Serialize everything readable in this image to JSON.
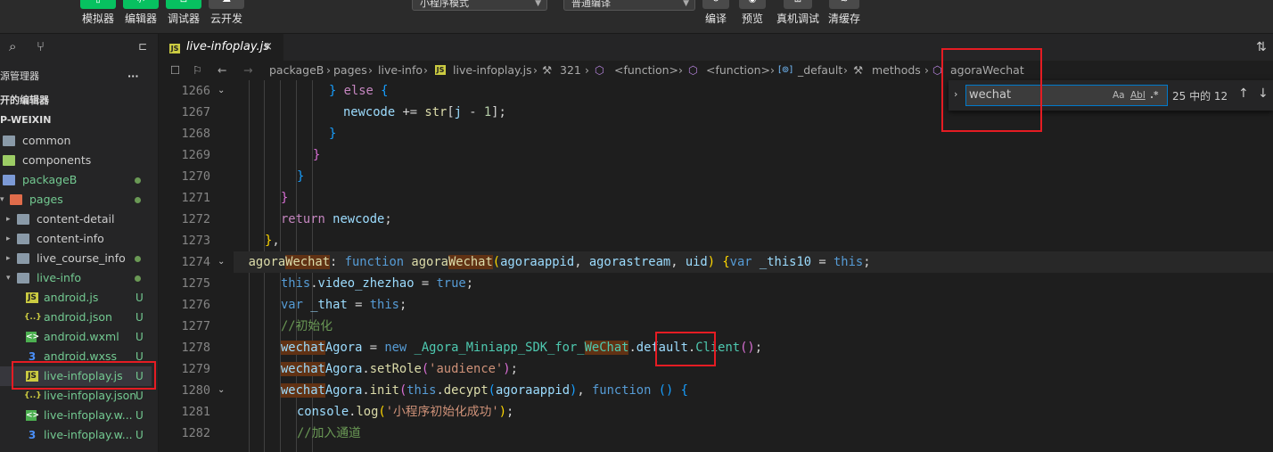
{
  "toolbar": {
    "buttons": [
      {
        "label": "模拟器"
      },
      {
        "label": "编辑器"
      },
      {
        "label": "调试器"
      },
      {
        "label": "云开发"
      },
      {
        "label": "编译"
      },
      {
        "label": "预览"
      },
      {
        "label": "真机调试"
      },
      {
        "label": "清缓存"
      }
    ],
    "mode_select": "小程序模式",
    "compile_select": "普通编译"
  },
  "sidebar": {
    "explorer_title": "源管理器",
    "more_label": "···",
    "open_editors": "开的编辑器",
    "project": "P-WEIXIN",
    "tree": [
      {
        "name": "common"
      },
      {
        "name": "components"
      },
      {
        "name": "packageB"
      },
      {
        "name": "pages"
      },
      {
        "name": "content-detail"
      },
      {
        "name": "content-info"
      },
      {
        "name": "live_course_info"
      },
      {
        "name": "live-info"
      },
      {
        "name": "android.js",
        "badge": "U"
      },
      {
        "name": "android.json",
        "badge": "U"
      },
      {
        "name": "android.wxml",
        "badge": "U"
      },
      {
        "name": "android.wxss",
        "badge": "U"
      },
      {
        "name": "live-infoplay.js",
        "badge": "U"
      },
      {
        "name": "live-infoplay.json",
        "badge": "U"
      },
      {
        "name": "live-infoplay.w...",
        "badge": "U"
      },
      {
        "name": "live-infoplay.w...",
        "badge": "U"
      }
    ]
  },
  "editor": {
    "tab": {
      "label": "live-infoplay.js",
      "close": "×"
    },
    "breadcrumb": [
      "packageB",
      "pages",
      "live-info",
      "live-infoplay.js",
      "321",
      "<function>",
      "<function>",
      "_default",
      "methods",
      "agoraWechat"
    ],
    "line_numbers": [
      "1266",
      "1267",
      "1268",
      "1269",
      "1270",
      "1271",
      "1272",
      "1273",
      "1274",
      "1275",
      "1276",
      "1277",
      "1278",
      "1279",
      "1280",
      "1281",
      "1282"
    ]
  },
  "find": {
    "query": "wechat",
    "match_case": "Aa",
    "whole_word": "Abl",
    "regex": ".*",
    "count": "25 中的 12"
  }
}
